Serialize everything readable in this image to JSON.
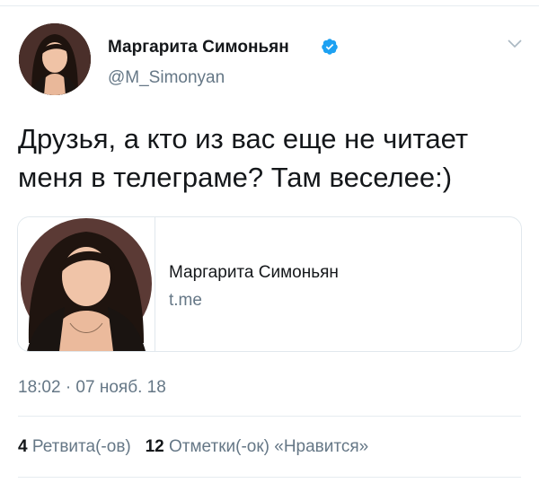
{
  "tweet": {
    "author_name": "Маргарита Симоньян",
    "author_handle": "@M_Simonyan",
    "verified": true,
    "text": "Друзья, а кто из вас еще не читает\nменя в телеграме? Там веселее:)",
    "timestamp": "18:02 · 07 нояб. 18"
  },
  "card": {
    "title": "Маргарита Симоньян",
    "domain": "t.me"
  },
  "stats": {
    "retweets_count": "4",
    "retweets_label": "Ретвита(-ов)",
    "likes_count": "12",
    "likes_label": "Отметки(-ок) «Нравится»"
  },
  "icons": {
    "verified": "verified-badge-icon",
    "menu": "chevron-down-icon"
  },
  "colors": {
    "verified": "#1da1f2",
    "secondary_text": "#657786",
    "primary_text": "#14171a",
    "divider": "#e6ecf0"
  }
}
